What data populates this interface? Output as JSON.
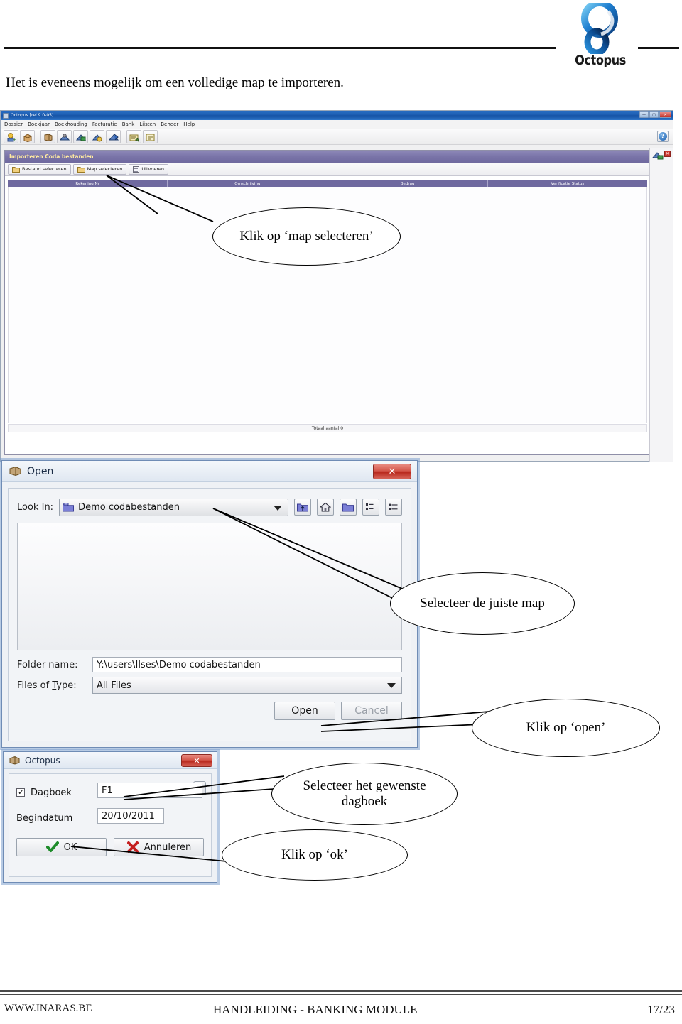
{
  "page": {
    "intro_text": "Het is eveneens mogelijk om een volledige map te importeren.",
    "brand": "Octopus"
  },
  "app_window": {
    "title": "Octopus [rel 9.0-05]",
    "window_buttons": {
      "minimize": "—",
      "maximize": "□",
      "close": "✕"
    },
    "menu": [
      "Dossier",
      "Boekjaar",
      "Boekhouding",
      "Facturatie",
      "Bank",
      "Lijsten",
      "Beheer",
      "Help"
    ],
    "help_button_label": "?",
    "panel": {
      "title": "Importeren Coda bestanden",
      "tools": [
        {
          "label": "Bestand selecteren",
          "icon": "folder-icon"
        },
        {
          "label": "Map selecteren",
          "icon": "folder-icon"
        },
        {
          "label": "Uitvoeren",
          "icon": "document-icon"
        }
      ],
      "grid_columns": [
        "Rekening Nr",
        "Omschrijving",
        "Bedrag",
        "Verificatie Status"
      ],
      "total_label": "Totaal aantal 0",
      "mini_close_label": "✕"
    }
  },
  "open_dialog": {
    "title": "Open",
    "close_label": "✕",
    "look_in_label_a": "Look ",
    "look_in_label_b": "I",
    "look_in_label_c": "n:",
    "look_in_value": "Demo codabestanden",
    "nav_icons": [
      "up-folder-icon",
      "home-icon",
      "new-folder-icon",
      "tiles-view-icon",
      "details-view-icon"
    ],
    "folder_name_label": "Folder name:",
    "folder_name_value": "Y:\\users\\Ilses\\Demo codabestanden",
    "files_of_type_label_a": "Files of ",
    "files_of_type_label_b": "T",
    "files_of_type_label_c": "ype:",
    "files_of_type_value": "All Files",
    "open_button": "Open",
    "cancel_button": "Cancel"
  },
  "octopus_dialog": {
    "title": "Octopus",
    "close_label": "✕",
    "dagboek_label": "Dagboek",
    "dagboek_value": "F1",
    "begindatum_label": "Begindatum",
    "begindatum_value": "20/10/2011",
    "ok_button": "OK",
    "cancel_button": "Annuleren"
  },
  "callouts": [
    {
      "id": "map-selecteren",
      "text": "Klik op ‘map selecteren’"
    },
    {
      "id": "juiste-map",
      "text": "Selecteer de juiste map"
    },
    {
      "id": "klik-open",
      "text": "Klik op ‘open’"
    },
    {
      "id": "dagboek",
      "text": "Selecteer het gewenste dagboek"
    },
    {
      "id": "klik-ok",
      "text": "Klik op ‘ok’"
    }
  ],
  "footer": {
    "website": "WWW.INARAS.BE",
    "center": "HANDLEIDING - BANKING MODULE",
    "page_number": "17/23"
  }
}
